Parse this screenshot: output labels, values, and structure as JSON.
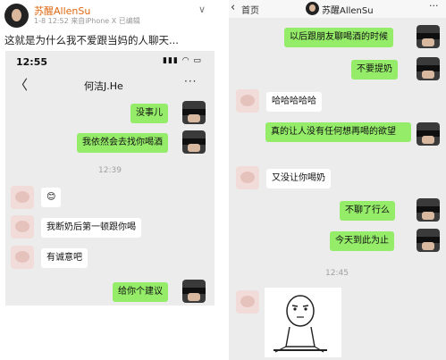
{
  "weibo": {
    "username": "苏醒AllenSu",
    "meta": "1-8 12:52 来自iPhone X  已编辑",
    "post_text": "这就是为什么我不爱跟当妈的人聊天..."
  },
  "left_chat": {
    "status_time": "12:55",
    "status_icons": "▮▮▮ ◠ ▭",
    "contact_title": "何洁J.He",
    "back_glyph": "〈",
    "more_glyph": "···",
    "timestamp": "12:39",
    "messages": [
      {
        "side": "right",
        "text": "没事儿"
      },
      {
        "side": "right",
        "text": "我依然会去找你喝酒"
      },
      {
        "side": "left",
        "text": "😊"
      },
      {
        "side": "left",
        "text": "我断奶后第一顿跟你喝"
      },
      {
        "side": "left",
        "text": "有诚意吧"
      },
      {
        "side": "right",
        "text": "给你个建议"
      }
    ]
  },
  "right_chat": {
    "back_label": "首页",
    "header_name": "苏醒AllenSu",
    "more_glyph": "···",
    "timestamp": "12:45",
    "messages": [
      {
        "side": "right",
        "text": "以后跟朋友聊喝酒的时候"
      },
      {
        "side": "right",
        "text": "不要提奶"
      },
      {
        "side": "left",
        "text": "哈哈哈哈哈"
      },
      {
        "side": "right",
        "text": "真的让人没有任何想再喝的欲望"
      },
      {
        "side": "left",
        "text": "又没让你喝奶"
      },
      {
        "side": "right",
        "text": "不聊了行么"
      },
      {
        "side": "right",
        "text": "今天到此为止"
      }
    ]
  },
  "colors": {
    "sent_bubble": "#95ec69",
    "received_bubble": "#ffffff",
    "chat_background": "#ececec",
    "weibo_name": "#e0670f"
  }
}
